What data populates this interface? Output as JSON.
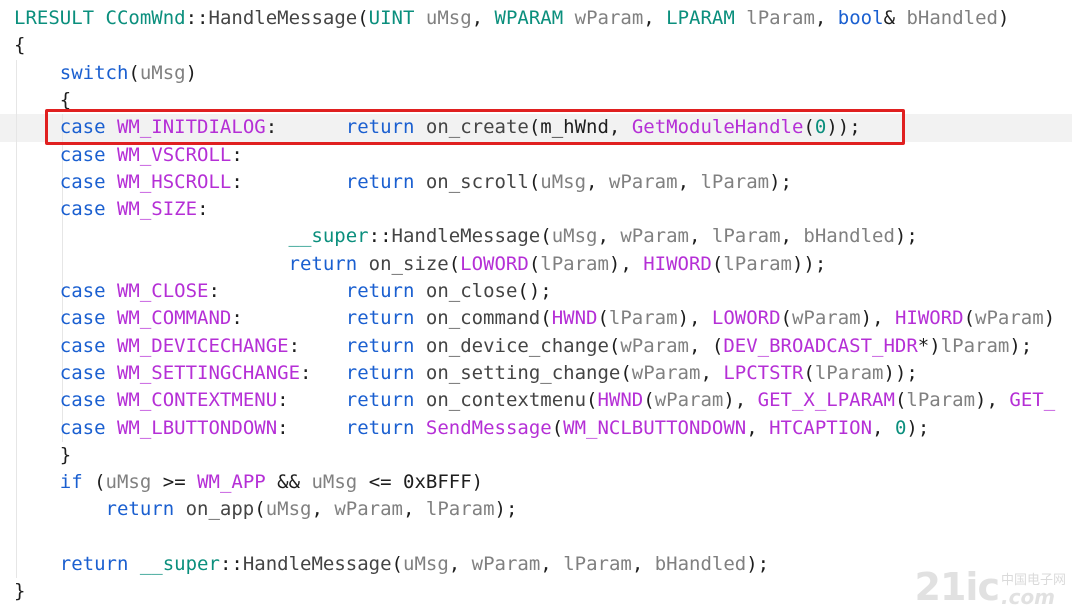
{
  "editor": {
    "lines": [
      [
        {
          "t": "LRESULT",
          "c": "type"
        },
        {
          "t": " "
        },
        {
          "t": "CComWnd",
          "c": "type"
        },
        {
          "t": "::"
        },
        {
          "t": "HandleMessage",
          "c": "fn"
        },
        {
          "t": "("
        },
        {
          "t": "UINT",
          "c": "type"
        },
        {
          "t": " "
        },
        {
          "t": "uMsg",
          "c": "param"
        },
        {
          "t": ", "
        },
        {
          "t": "WPARAM",
          "c": "type"
        },
        {
          "t": " "
        },
        {
          "t": "wParam",
          "c": "param"
        },
        {
          "t": ", "
        },
        {
          "t": "LPARAM",
          "c": "type"
        },
        {
          "t": " "
        },
        {
          "t": "lParam",
          "c": "param"
        },
        {
          "t": ", "
        },
        {
          "t": "bool",
          "c": "kw"
        },
        {
          "t": "& "
        },
        {
          "t": "bHandled",
          "c": "param"
        },
        {
          "t": ")"
        }
      ],
      [
        {
          "t": "{"
        }
      ],
      [
        {
          "t": "    "
        },
        {
          "t": "switch",
          "c": "kw"
        },
        {
          "t": "("
        },
        {
          "t": "uMsg",
          "c": "param"
        },
        {
          "t": ")"
        }
      ],
      [
        {
          "t": "    {"
        }
      ],
      [
        {
          "t": "    "
        },
        {
          "t": "case",
          "c": "kw"
        },
        {
          "t": " "
        },
        {
          "t": "WM_INITDIALOG",
          "c": "macro"
        },
        {
          "t": ":      "
        },
        {
          "t": "return",
          "c": "kw"
        },
        {
          "t": " "
        },
        {
          "t": "on_create",
          "c": "fn"
        },
        {
          "t": "("
        },
        {
          "t": "m_hWnd"
        },
        {
          "t": ", "
        },
        {
          "t": "GetModuleHandle",
          "c": "macro"
        },
        {
          "t": "("
        },
        {
          "t": "0",
          "c": "num"
        },
        {
          "t": "));"
        }
      ],
      [
        {
          "t": "    "
        },
        {
          "t": "case",
          "c": "kw"
        },
        {
          "t": " "
        },
        {
          "t": "WM_VSCROLL",
          "c": "macro"
        },
        {
          "t": ":"
        }
      ],
      [
        {
          "t": "    "
        },
        {
          "t": "case",
          "c": "kw"
        },
        {
          "t": " "
        },
        {
          "t": "WM_HSCROLL",
          "c": "macro"
        },
        {
          "t": ":         "
        },
        {
          "t": "return",
          "c": "kw"
        },
        {
          "t": " "
        },
        {
          "t": "on_scroll",
          "c": "fn"
        },
        {
          "t": "("
        },
        {
          "t": "uMsg",
          "c": "param"
        },
        {
          "t": ", "
        },
        {
          "t": "wParam",
          "c": "param"
        },
        {
          "t": ", "
        },
        {
          "t": "lParam",
          "c": "param"
        },
        {
          "t": ");"
        }
      ],
      [
        {
          "t": "    "
        },
        {
          "t": "case",
          "c": "kw"
        },
        {
          "t": " "
        },
        {
          "t": "WM_SIZE",
          "c": "macro"
        },
        {
          "t": ":"
        }
      ],
      [
        {
          "t": "                        "
        },
        {
          "t": "__super",
          "c": "super"
        },
        {
          "t": "::"
        },
        {
          "t": "HandleMessage",
          "c": "fn"
        },
        {
          "t": "("
        },
        {
          "t": "uMsg",
          "c": "param"
        },
        {
          "t": ", "
        },
        {
          "t": "wParam",
          "c": "param"
        },
        {
          "t": ", "
        },
        {
          "t": "lParam",
          "c": "param"
        },
        {
          "t": ", "
        },
        {
          "t": "bHandled",
          "c": "param"
        },
        {
          "t": ");"
        }
      ],
      [
        {
          "t": "                        "
        },
        {
          "t": "return",
          "c": "kw"
        },
        {
          "t": " "
        },
        {
          "t": "on_size",
          "c": "fn"
        },
        {
          "t": "("
        },
        {
          "t": "LOWORD",
          "c": "macro"
        },
        {
          "t": "("
        },
        {
          "t": "lParam",
          "c": "param"
        },
        {
          "t": "), "
        },
        {
          "t": "HIWORD",
          "c": "macro"
        },
        {
          "t": "("
        },
        {
          "t": "lParam",
          "c": "param"
        },
        {
          "t": "));"
        }
      ],
      [
        {
          "t": "    "
        },
        {
          "t": "case",
          "c": "kw"
        },
        {
          "t": " "
        },
        {
          "t": "WM_CLOSE",
          "c": "macro"
        },
        {
          "t": ":           "
        },
        {
          "t": "return",
          "c": "kw"
        },
        {
          "t": " "
        },
        {
          "t": "on_close",
          "c": "fn"
        },
        {
          "t": "();"
        }
      ],
      [
        {
          "t": "    "
        },
        {
          "t": "case",
          "c": "kw"
        },
        {
          "t": " "
        },
        {
          "t": "WM_COMMAND",
          "c": "macro"
        },
        {
          "t": ":         "
        },
        {
          "t": "return",
          "c": "kw"
        },
        {
          "t": " "
        },
        {
          "t": "on_command",
          "c": "fn"
        },
        {
          "t": "("
        },
        {
          "t": "HWND",
          "c": "macro"
        },
        {
          "t": "("
        },
        {
          "t": "lParam",
          "c": "param"
        },
        {
          "t": "), "
        },
        {
          "t": "LOWORD",
          "c": "macro"
        },
        {
          "t": "("
        },
        {
          "t": "wParam",
          "c": "param"
        },
        {
          "t": "), "
        },
        {
          "t": "HIWORD",
          "c": "macro"
        },
        {
          "t": "("
        },
        {
          "t": "wParam",
          "c": "param"
        },
        {
          "t": ")"
        }
      ],
      [
        {
          "t": "    "
        },
        {
          "t": "case",
          "c": "kw"
        },
        {
          "t": " "
        },
        {
          "t": "WM_DEVICECHANGE",
          "c": "macro"
        },
        {
          "t": ":    "
        },
        {
          "t": "return",
          "c": "kw"
        },
        {
          "t": " "
        },
        {
          "t": "on_device_change",
          "c": "fn"
        },
        {
          "t": "("
        },
        {
          "t": "wParam",
          "c": "param"
        },
        {
          "t": ", ("
        },
        {
          "t": "DEV_BROADCAST_HDR",
          "c": "macro"
        },
        {
          "t": "*)"
        },
        {
          "t": "lParam",
          "c": "param"
        },
        {
          "t": ");"
        }
      ],
      [
        {
          "t": "    "
        },
        {
          "t": "case",
          "c": "kw"
        },
        {
          "t": " "
        },
        {
          "t": "WM_SETTINGCHANGE",
          "c": "macro"
        },
        {
          "t": ":   "
        },
        {
          "t": "return",
          "c": "kw"
        },
        {
          "t": " "
        },
        {
          "t": "on_setting_change",
          "c": "fn"
        },
        {
          "t": "("
        },
        {
          "t": "wParam",
          "c": "param"
        },
        {
          "t": ", "
        },
        {
          "t": "LPCTSTR",
          "c": "macro"
        },
        {
          "t": "("
        },
        {
          "t": "lParam",
          "c": "param"
        },
        {
          "t": "));"
        }
      ],
      [
        {
          "t": "    "
        },
        {
          "t": "case",
          "c": "kw"
        },
        {
          "t": " "
        },
        {
          "t": "WM_CONTEXTMENU",
          "c": "macro"
        },
        {
          "t": ":     "
        },
        {
          "t": "return",
          "c": "kw"
        },
        {
          "t": " "
        },
        {
          "t": "on_contextmenu",
          "c": "fn"
        },
        {
          "t": "("
        },
        {
          "t": "HWND",
          "c": "macro"
        },
        {
          "t": "("
        },
        {
          "t": "wParam",
          "c": "param"
        },
        {
          "t": "), "
        },
        {
          "t": "GET_X_LPARAM",
          "c": "macro"
        },
        {
          "t": "("
        },
        {
          "t": "lParam",
          "c": "param"
        },
        {
          "t": "), "
        },
        {
          "t": "GET_",
          "c": "macro"
        }
      ],
      [
        {
          "t": "    "
        },
        {
          "t": "case",
          "c": "kw"
        },
        {
          "t": " "
        },
        {
          "t": "WM_LBUTTONDOWN",
          "c": "macro"
        },
        {
          "t": ":     "
        },
        {
          "t": "return",
          "c": "kw"
        },
        {
          "t": " "
        },
        {
          "t": "SendMessage",
          "c": "macro"
        },
        {
          "t": "("
        },
        {
          "t": "WM_NCLBUTTONDOWN",
          "c": "macro"
        },
        {
          "t": ", "
        },
        {
          "t": "HTCAPTION",
          "c": "macro"
        },
        {
          "t": ", "
        },
        {
          "t": "0",
          "c": "num"
        },
        {
          "t": ");"
        }
      ],
      [
        {
          "t": "    }"
        }
      ],
      [
        {
          "t": "    "
        },
        {
          "t": "if",
          "c": "kw"
        },
        {
          "t": " ("
        },
        {
          "t": "uMsg",
          "c": "param"
        },
        {
          "t": " >= "
        },
        {
          "t": "WM_APP",
          "c": "macro"
        },
        {
          "t": " && "
        },
        {
          "t": "uMsg",
          "c": "param"
        },
        {
          "t": " <= "
        },
        {
          "t": "0xBFFF",
          "c": "hex"
        },
        {
          "t": ")"
        }
      ],
      [
        {
          "t": "        "
        },
        {
          "t": "return",
          "c": "kw"
        },
        {
          "t": " "
        },
        {
          "t": "on_app",
          "c": "fn"
        },
        {
          "t": "("
        },
        {
          "t": "uMsg",
          "c": "param"
        },
        {
          "t": ", "
        },
        {
          "t": "wParam",
          "c": "param"
        },
        {
          "t": ", "
        },
        {
          "t": "lParam",
          "c": "param"
        },
        {
          "t": ");"
        }
      ],
      [
        {
          "t": ""
        }
      ],
      [
        {
          "t": "    "
        },
        {
          "t": "return",
          "c": "kw"
        },
        {
          "t": " "
        },
        {
          "t": "__super",
          "c": "super"
        },
        {
          "t": "::"
        },
        {
          "t": "HandleMessage",
          "c": "fn"
        },
        {
          "t": "("
        },
        {
          "t": "uMsg",
          "c": "param"
        },
        {
          "t": ", "
        },
        {
          "t": "wParam",
          "c": "param"
        },
        {
          "t": ", "
        },
        {
          "t": "lParam",
          "c": "param"
        },
        {
          "t": ", "
        },
        {
          "t": "bHandled",
          "c": "param"
        },
        {
          "t": ");"
        }
      ],
      [
        {
          "t": "}"
        }
      ]
    ]
  },
  "highlight": {
    "line_index": 4,
    "color": "#e02020"
  },
  "colors": {
    "type": "#0b8f7d",
    "keyword": "#1a5fd0",
    "macro": "#b52fd6",
    "param": "#808080",
    "background": "#ffffff",
    "current_line": "#f2f2f2"
  },
  "watermark": {
    "logo": "21ic",
    "cn": "中国电子网",
    "domain": ".com"
  }
}
